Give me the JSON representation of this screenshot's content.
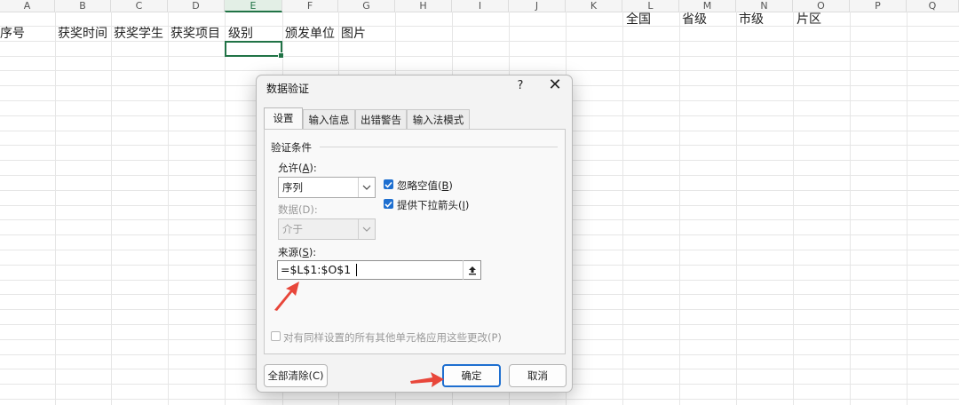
{
  "sheet": {
    "columns": [
      "A",
      "B",
      "C",
      "D",
      "E",
      "F",
      "G",
      "H",
      "I",
      "J",
      "K",
      "L",
      "M",
      "N",
      "O",
      "P",
      "Q"
    ],
    "row1": {
      "L": "全国",
      "M": "省级",
      "N": "市级",
      "O": "片区"
    },
    "row2": {
      "A": "序号",
      "B": "获奖时间",
      "C": "获奖学生",
      "D": "获奖项目",
      "E": "级别",
      "F": "颁发单位",
      "G": "图片"
    }
  },
  "dialog": {
    "title": "数据验证",
    "help": "?",
    "close": "✕",
    "tabs": [
      "设置",
      "输入信息",
      "出错警告",
      "输入法模式"
    ],
    "group_label": "验证条件",
    "allow_label": "允许(",
    "allow_key": "A",
    "allow_suffix": "):",
    "allow_value": "序列",
    "data_label": "数据(D):",
    "data_value": "介于",
    "ignore_blank_label": "忽略空值(",
    "ignore_blank_key": "B",
    "ignore_blank_suffix": ")",
    "dropdown_label": "提供下拉箭头(",
    "dropdown_key": "I",
    "dropdown_suffix": ")",
    "source_label": "来源(",
    "source_key": "S",
    "source_suffix": "):",
    "source_value": "=$L$1:$O$1",
    "apply_all_label": "对有同样设置的所有其他单元格应用这些更改(P)",
    "clear_all": "全部清除(C)",
    "ok": "确定",
    "cancel": "取消"
  },
  "colors": {
    "accent": "#217346",
    "button_blue": "#1e6fd0",
    "annotation_red": "#e8463a"
  }
}
